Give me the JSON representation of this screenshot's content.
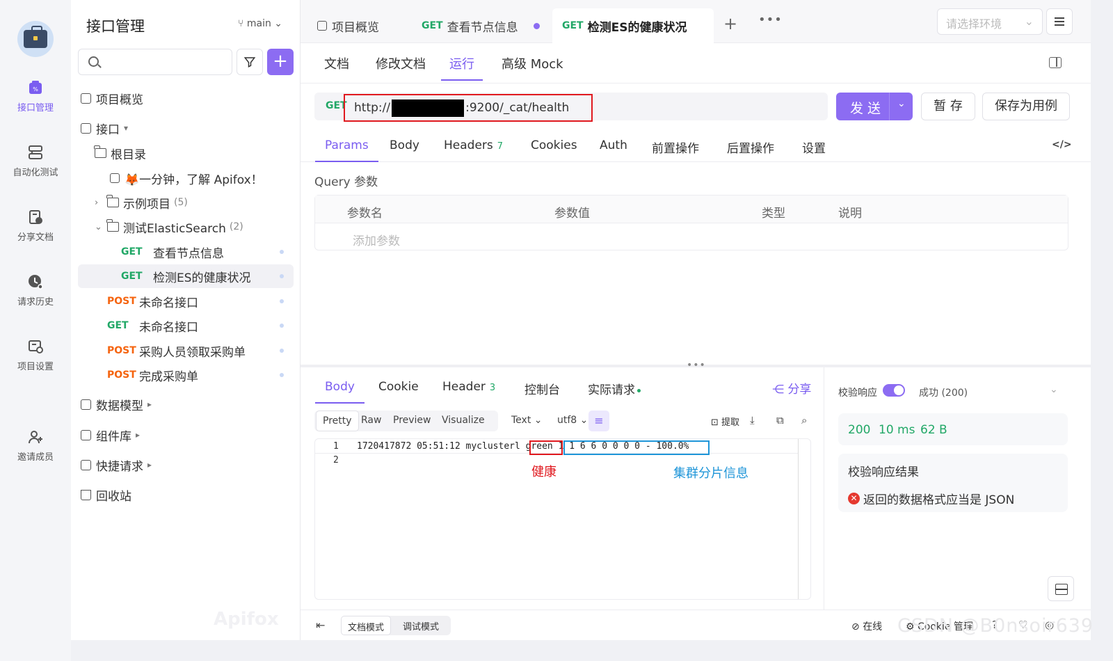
{
  "rail": {
    "items": [
      {
        "label": "接口管理",
        "icon": "api-manage-icon",
        "active": true
      },
      {
        "label": "自动化测试",
        "icon": "automation-icon"
      },
      {
        "label": "分享文档",
        "icon": "share-doc-icon"
      },
      {
        "label": "请求历史",
        "icon": "history-icon"
      },
      {
        "label": "项目设置",
        "icon": "project-settings-icon"
      },
      {
        "label": "邀请成员",
        "icon": "invite-member-icon"
      }
    ]
  },
  "sidebar": {
    "title": "接口管理",
    "branch": "main",
    "tree": {
      "overview": "项目概览",
      "api_root": "接口",
      "root_dir": "根目录",
      "intro_doc": "🦊一分钟，了解 Apifox！",
      "example_project": {
        "label": "示例项目",
        "count": "(5)"
      },
      "es_folder": {
        "label": "测试ElasticSearch",
        "count": "(2)"
      },
      "es_items": [
        {
          "method": "GET",
          "label": "查看节点信息"
        },
        {
          "method": "GET",
          "label": "检测ES的健康状况"
        }
      ],
      "root_items": [
        {
          "method": "POST",
          "label": "未命名接口"
        },
        {
          "method": "GET",
          "label": "未命名接口"
        },
        {
          "method": "POST",
          "label": "采购人员领取采购单"
        },
        {
          "method": "POST",
          "label": "完成采购单"
        }
      ],
      "data_model": "数据模型",
      "components": "组件库",
      "quick_request": "快捷请求",
      "recycle_bin": "回收站"
    },
    "watermark": "Apifox"
  },
  "tabs": [
    {
      "label": "项目概览"
    },
    {
      "method": "GET",
      "label": "查看节点信息"
    },
    {
      "method": "GET",
      "label": "检测ES的健康状况"
    }
  ],
  "env_placeholder": "请选择环境",
  "subtabs": [
    "文档",
    "修改文档",
    "运行",
    "高级 Mock"
  ],
  "request": {
    "method": "GET",
    "url_prefix": "http://",
    "url_suffix": ":9200/_cat/health",
    "send_label": "发 送",
    "save_label": "暂 存",
    "save_case_label": "保存为用例"
  },
  "req_tabs": [
    {
      "label": "Params"
    },
    {
      "label": "Body"
    },
    {
      "label": "Headers",
      "badge": "7"
    },
    {
      "label": "Cookies"
    },
    {
      "label": "Auth"
    },
    {
      "label": "前置操作"
    },
    {
      "label": "后置操作"
    },
    {
      "label": "设置"
    }
  ],
  "query": {
    "label": "Query 参数",
    "columns": [
      "参数名",
      "参数值",
      "类型",
      "说明"
    ],
    "add_placeholder": "添加参数"
  },
  "response": {
    "tabs": [
      {
        "label": "Body"
      },
      {
        "label": "Cookie"
      },
      {
        "label": "Header",
        "badge": "3"
      },
      {
        "label": "控制台"
      },
      {
        "label": "实际请求"
      }
    ],
    "share_label": "分享",
    "formats": [
      "Pretty",
      "Raw",
      "Preview",
      "Visualize"
    ],
    "type_select": "Text",
    "encoding_select": "utf8",
    "extract_label": "提取",
    "lines": [
      "1",
      "2"
    ],
    "body_line": "1720417872 05:51:12 myclusterl green 1 1 6 6 0 0 0 0 - 100.0%",
    "annotation_health": "健康",
    "annotation_shards": "集群分片信息"
  },
  "validation": {
    "label": "校验响应",
    "status": "成功 (200)",
    "code": "200",
    "time": "10 ms",
    "size": "62 B",
    "result_title": "校验响应结果",
    "error": "返回的数据格式应当是 JSON"
  },
  "statusbar": {
    "modes": [
      "文档模式",
      "调试模式"
    ],
    "online": "在线",
    "cookie": "Cookie 管理"
  },
  "watermark_csdn": "CSDN @B0nsoir639"
}
